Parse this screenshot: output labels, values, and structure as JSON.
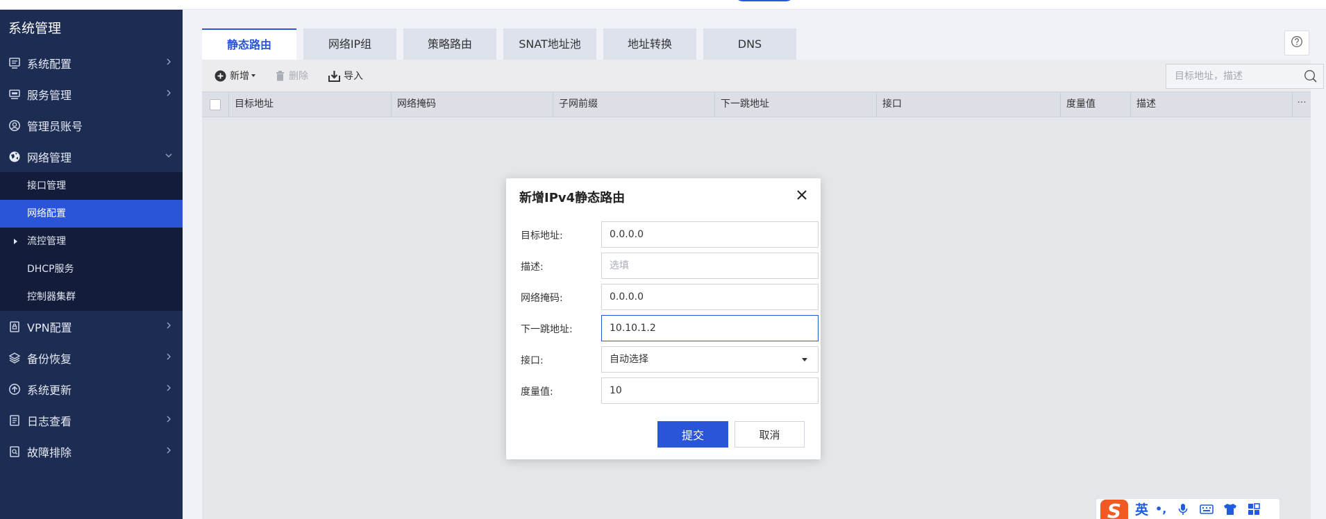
{
  "sidebar": {
    "title": "系统管理",
    "items": [
      {
        "label": "系统配置",
        "icon": "monitor-icon"
      },
      {
        "label": "服务管理",
        "icon": "server-icon"
      },
      {
        "label": "管理员账号",
        "icon": "user-icon"
      },
      {
        "label": "网络管理",
        "icon": "globe-icon",
        "expanded": true
      },
      {
        "label": "VPN配置",
        "icon": "lock-icon"
      },
      {
        "label": "备份恢复",
        "icon": "layers-icon"
      },
      {
        "label": "系统更新",
        "icon": "upload-icon"
      },
      {
        "label": "日志查看",
        "icon": "document-icon"
      },
      {
        "label": "故障排除",
        "icon": "search-doc-icon"
      }
    ],
    "subitems": [
      {
        "label": "接口管理"
      },
      {
        "label": "网络配置",
        "active": true
      },
      {
        "label": "流控管理"
      },
      {
        "label": "DHCP服务"
      },
      {
        "label": "控制器集群"
      }
    ]
  },
  "tabs": [
    "静态路由",
    "网络IP组",
    "策略路由",
    "SNAT地址池",
    "地址转换",
    "DNS"
  ],
  "toolbar": {
    "add_label": "新增",
    "delete_label": "删除",
    "import_label": "导入",
    "search_placeholder": "目标地址，描述"
  },
  "table": {
    "columns": [
      "目标地址",
      "网络掩码",
      "子网前缀",
      "下一跳地址",
      "接口",
      "度量值",
      "描述"
    ],
    "more": "···"
  },
  "dialog": {
    "title": "新增IPv4静态路由",
    "fields": {
      "dest": {
        "label": "目标地址:",
        "value": "0.0.0.0"
      },
      "desc": {
        "label": "描述:",
        "value": "",
        "placeholder": "选填"
      },
      "mask": {
        "label": "网络掩码:",
        "value": "0.0.0.0"
      },
      "nexthop": {
        "label": "下一跳地址:",
        "value": "10.10.1.2"
      },
      "iface": {
        "label": "接口:",
        "value": "自动选择"
      },
      "metric": {
        "label": "度量值:",
        "value": "10"
      }
    },
    "submit_label": "提交",
    "cancel_label": "取消"
  },
  "ime": {
    "logo": "S",
    "mode": "英",
    "punct": "•,"
  },
  "colors": {
    "accent": "#2a55d8",
    "sidebar_bg": "#1d2c52",
    "subnav_bg": "#131d3a"
  }
}
